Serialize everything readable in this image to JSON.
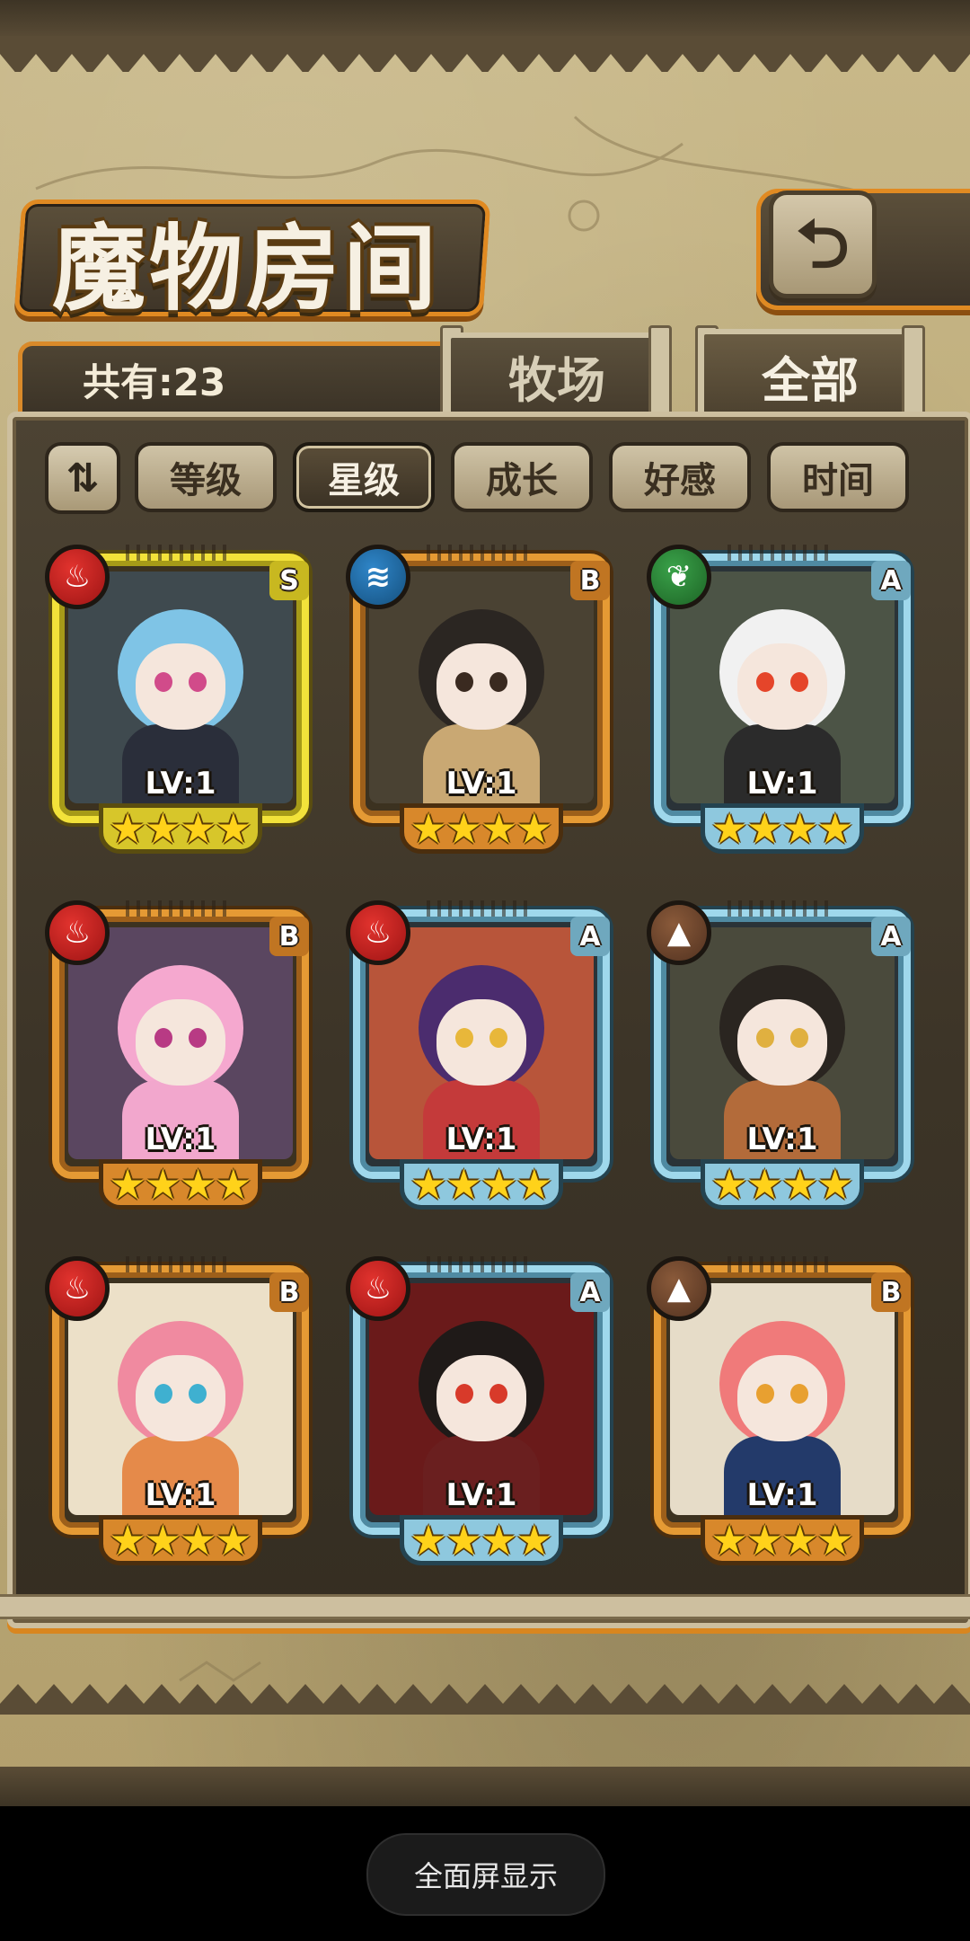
{
  "header": {
    "title": "魔物房间",
    "back_icon": "return-arrow-icon"
  },
  "summary": {
    "count_label": "共有:23"
  },
  "top_tabs": [
    {
      "label": "牧场",
      "selected": false
    },
    {
      "label": "全部",
      "selected": true
    }
  ],
  "sort": {
    "toggle_icon": "sort-order-icon",
    "toggle_glyph": "⇅",
    "buttons": [
      {
        "label": "等级",
        "active": false
      },
      {
        "label": "星级",
        "active": true
      },
      {
        "label": "成长",
        "active": false
      },
      {
        "label": "好感",
        "active": false
      },
      {
        "label": "时间",
        "active": false
      }
    ]
  },
  "monsters": [
    {
      "rank": "S",
      "element": "fire",
      "level": "LV:1",
      "stars": 4,
      "frame": "gold"
    },
    {
      "rank": "B",
      "element": "water",
      "level": "LV:1",
      "stars": 4,
      "frame": "orange"
    },
    {
      "rank": "A",
      "element": "wood",
      "level": "LV:1",
      "stars": 4,
      "frame": "blue"
    },
    {
      "rank": "B",
      "element": "fire",
      "level": "LV:1",
      "stars": 4,
      "frame": "orange"
    },
    {
      "rank": "A",
      "element": "fire",
      "level": "LV:1",
      "stars": 4,
      "frame": "blue"
    },
    {
      "rank": "A",
      "element": "earth",
      "level": "LV:1",
      "stars": 4,
      "frame": "blue"
    },
    {
      "rank": "B",
      "element": "fire",
      "level": "LV:1",
      "stars": 4,
      "frame": "orange"
    },
    {
      "rank": "A",
      "element": "fire",
      "level": "LV:1",
      "stars": 4,
      "frame": "blue"
    },
    {
      "rank": "B",
      "element": "earth",
      "level": "LV:1",
      "stars": 4,
      "frame": "orange"
    }
  ],
  "system": {
    "fullscreen_label": "全面屏显示"
  }
}
